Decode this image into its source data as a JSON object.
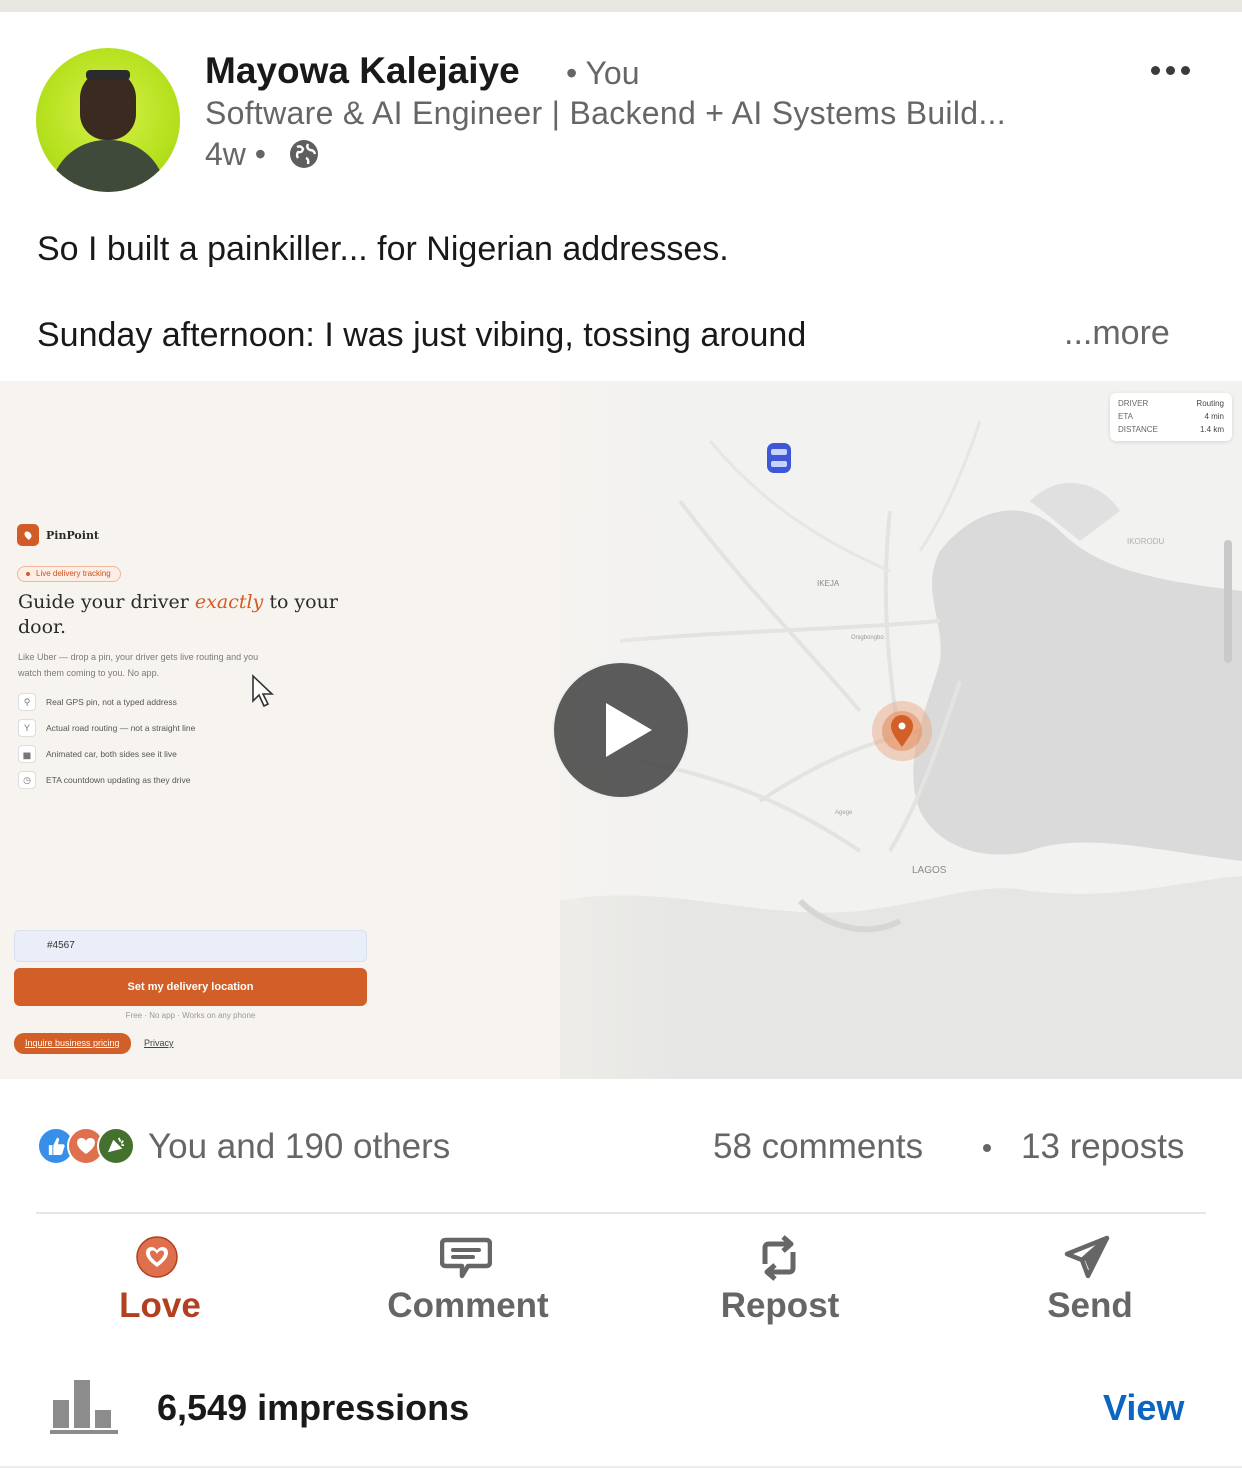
{
  "post": {
    "author_name": "Mayowa Kalejaiye",
    "author_relation": "• You",
    "headline": "Software & AI Engineer | Backend + AI Systems Build...",
    "time": "4w •",
    "visibility_icon": "globe-icon",
    "menu_icon": "more-horizontal-icon",
    "text_line_1": "So I built a painkiller... for Nigerian addresses.",
    "text_line_2": "Sunday afternoon: I was just vibing, tossing around",
    "see_more": "...more"
  },
  "media": {
    "brand": "PinPoint",
    "pill": "Live delivery tracking",
    "title_pre": "Guide your driver ",
    "title_em": "exactly",
    "title_post": " to your door.",
    "subtitle": "Like Uber — drop a pin, your driver gets live routing and you watch them coming to you. No app.",
    "features": [
      {
        "icon": "pin-icon",
        "glyph": "⚲",
        "label": "Real GPS pin, not a typed address"
      },
      {
        "icon": "route-icon",
        "glyph": "Y",
        "label": "Actual road routing — not a straight line"
      },
      {
        "icon": "car-icon",
        "glyph": "▅",
        "label": "Animated car, both sides see it live"
      },
      {
        "icon": "clock-icon",
        "glyph": "◷",
        "label": "ETA countdown updating as they drive"
      }
    ],
    "code_value": "#4567",
    "set_button": "Set my delivery location",
    "fine_print": "Free · No app · Works on any phone",
    "business_button": "Inquire business pricing",
    "privacy_link": "Privacy",
    "route_card": {
      "rows": [
        {
          "key": "DRIVER",
          "value": "Routing"
        },
        {
          "key": "ETA",
          "value": "4 min"
        },
        {
          "key": "DISTANCE",
          "value": "1.4 km"
        }
      ]
    },
    "map_labels": {
      "ikeja": "IKEJA",
      "lagos": "LAGOS",
      "ikorodu": "IKORODU",
      "oshodi": "Onigbongbo",
      "agege": "Agege"
    },
    "play_icon": "play-icon",
    "accent": "#d15f27"
  },
  "social": {
    "reactions_text": "You and 190 others",
    "comments": "58 comments",
    "reposts": "13 reposts",
    "reaction_icons": [
      "like-icon",
      "love-icon",
      "celebrate-icon"
    ]
  },
  "actions": {
    "love": "Love",
    "comment": "Comment",
    "repost": "Repost",
    "send": "Send",
    "love_color": "#b24020"
  },
  "footer": {
    "impressions": "6,549 impressions",
    "view": "View",
    "link_color": "#0a66c2"
  }
}
